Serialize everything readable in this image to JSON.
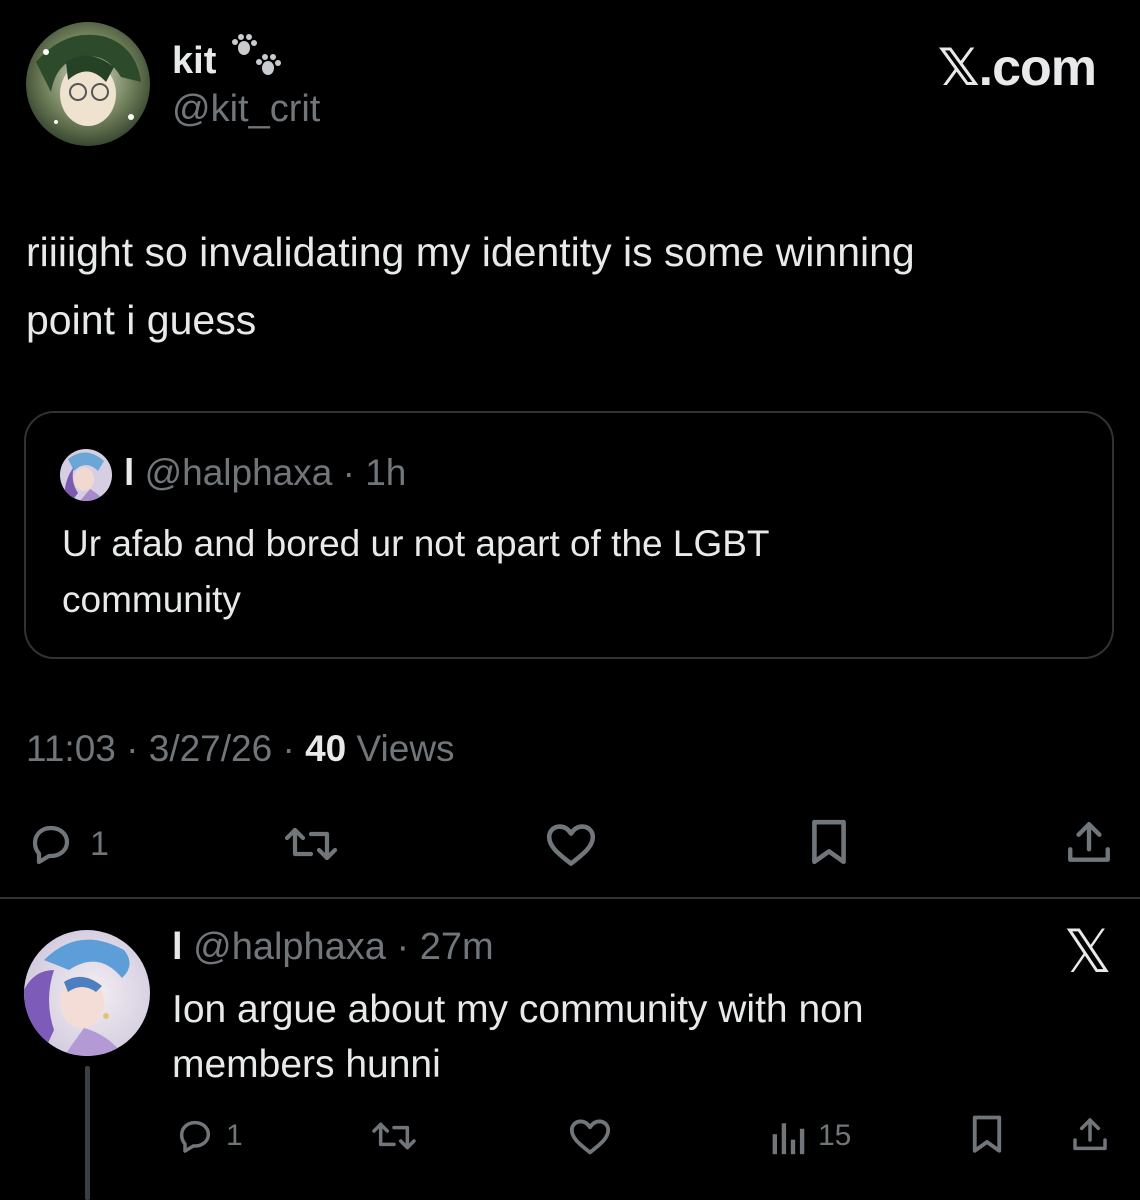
{
  "header": {
    "display_name": "kit",
    "handle": "@kit_crit",
    "brand": "𝕏.com"
  },
  "tweet": {
    "text_line1": "riiiight so invalidating my identity is some winning",
    "text_line2": "point i guess",
    "quote": {
      "name": "l",
      "handle": "@halphaxa",
      "sep": "·",
      "time": "1h",
      "text_line1": "Ur afab and bored ur not apart of the LGBT",
      "text_line2": "community"
    },
    "meta": {
      "time": "11:03",
      "sep1": "·",
      "date": "3/27/26",
      "sep2": "·",
      "views_count": "40",
      "views_label": "Views"
    },
    "actions": {
      "reply_count": "1",
      "reply_icon": "reply-icon",
      "retweet_icon": "retweet-icon",
      "like_icon": "heart-icon",
      "bookmark_icon": "bookmark-icon",
      "share_icon": "share-icon"
    }
  },
  "reply": {
    "name": "l",
    "handle": "@halphaxa",
    "sep": "·",
    "time": "27m",
    "close_label": "𝕏",
    "text_line1": "Ion argue about my community with non",
    "text_line2": "members hunni",
    "actions": {
      "reply_count": "1",
      "views_count": "15"
    }
  },
  "colors": {
    "background": "#000000",
    "text_primary": "#e7e9ea",
    "text_secondary": "#71767b",
    "border": "#2f3336"
  }
}
